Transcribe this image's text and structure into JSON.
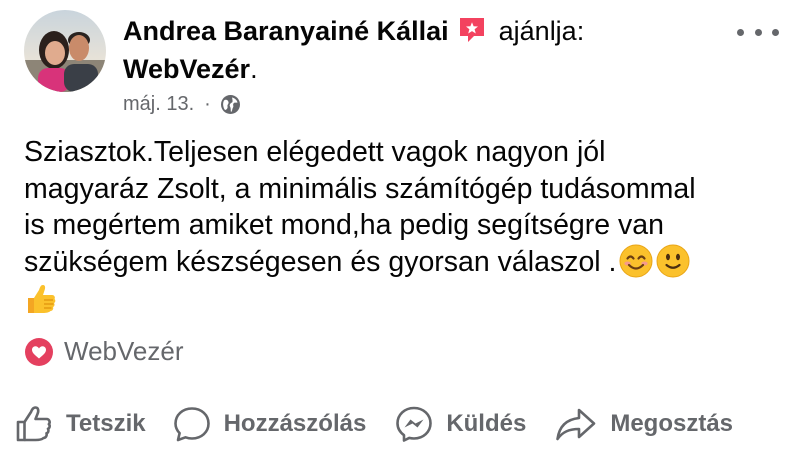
{
  "post": {
    "author": "Andrea Baranyainé Kállai",
    "action_text": "ajánlja:",
    "page_name": "WebVezér",
    "page_suffix": ".",
    "date": "máj. 13.",
    "separator": "·",
    "privacy_icon": "globe-icon",
    "body_lines": [
      "Sziasztok.Teljesen elégedett vagok nagyon jól",
      "magyaráz Zsolt, a minimális számítógép tudásommal",
      "is megértem amiket mond,ha pedig segítségre van",
      "szükségem készségesen és gyorsan válaszol ."
    ],
    "emojis": [
      "smiling-face-with-smiling-eyes",
      "slightly-smiling-face",
      "thumbs-up"
    ],
    "recommended_page_label": "WebVezér"
  },
  "actions": {
    "like": "Tetszik",
    "comment": "Hozzászólás",
    "send": "Küldés",
    "share": "Megosztás"
  },
  "colors": {
    "text": "#050505",
    "secondary_text": "#65676b",
    "recommend_badge": "#f3425f",
    "heart": "#e4405f",
    "emoji_yellow": "#fbc12c"
  }
}
